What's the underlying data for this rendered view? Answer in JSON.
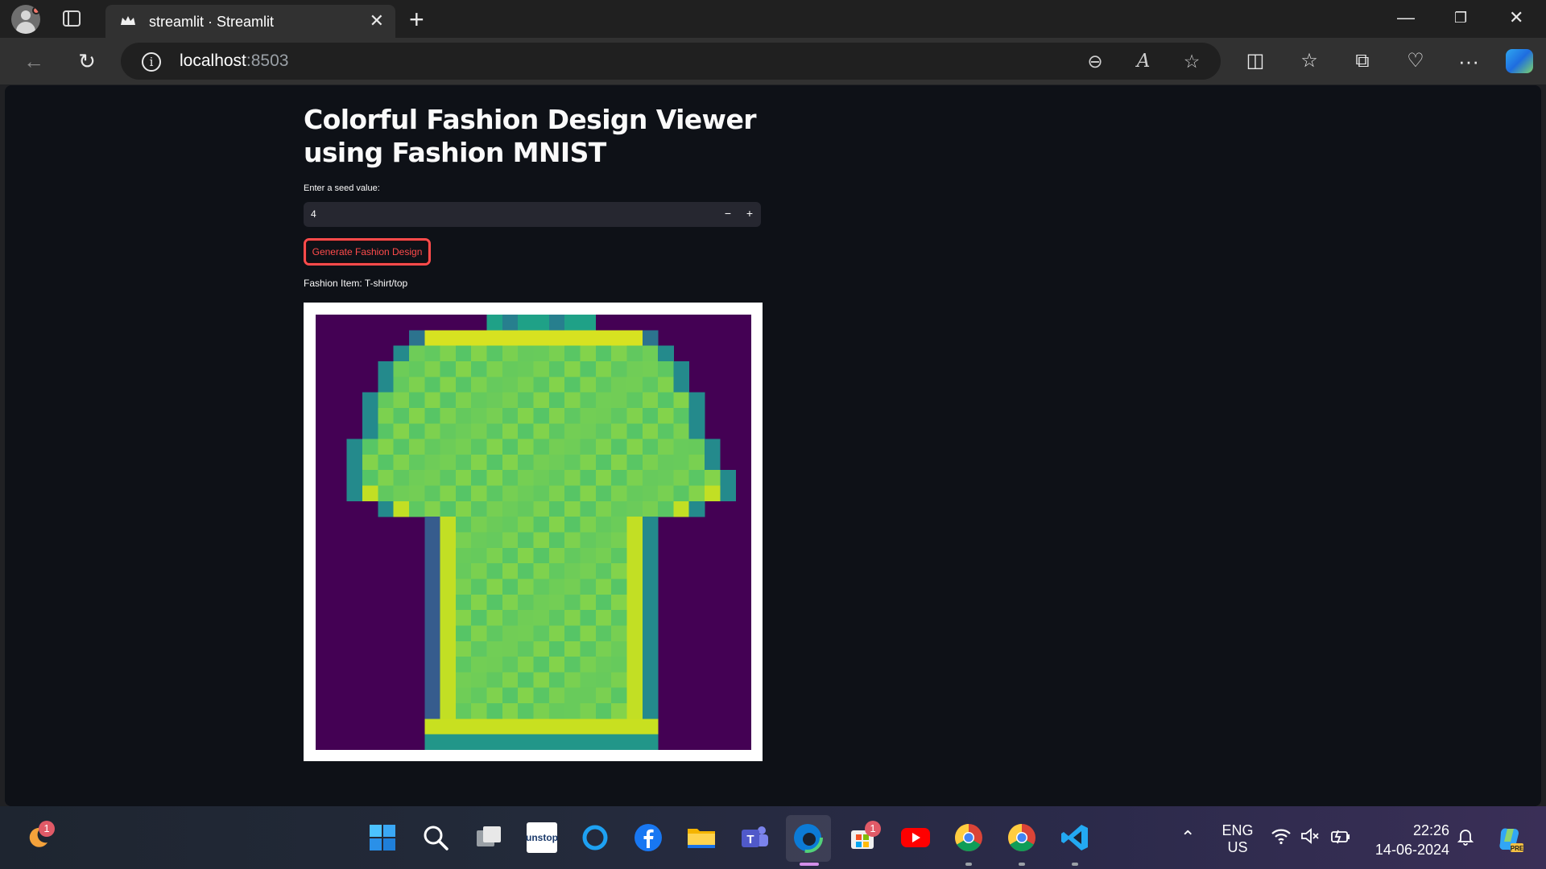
{
  "browser": {
    "tab_title": "streamlit · Streamlit",
    "url_host": "localhost",
    "url_port": ":8503"
  },
  "app": {
    "title": "Colorful Fashion Design Viewer using Fashion MNIST",
    "seed_label": "Enter a seed value:",
    "seed_value": "4",
    "decrement_label": "−",
    "increment_label": "+",
    "generate_button": "Generate Fashion Design",
    "fashion_item_text": "Fashion Item: T-shirt/top",
    "accent_color": "#ff4b4b",
    "image_colormap": "viridis",
    "image_size": 28
  },
  "taskbar": {
    "language_top": "ENG",
    "language_bottom": "US",
    "time": "22:26",
    "date": "14-06-2024",
    "notification_badge": "1",
    "store_badge": "1"
  }
}
